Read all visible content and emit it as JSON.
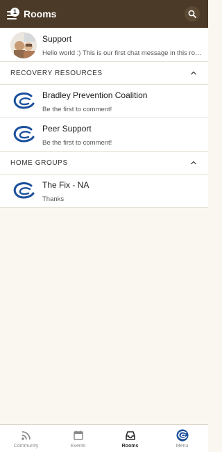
{
  "header": {
    "title": "Rooms",
    "notification_count": "1"
  },
  "rooms_top": [
    {
      "name": "Support",
      "last_message": "Hello world :) This is our first chat message in this room"
    }
  ],
  "sections": [
    {
      "label": "RECOVERY RESOURCES",
      "rooms": [
        {
          "name": "Bradley Prevention Coalition",
          "last_message": "Be the first to comment!"
        },
        {
          "name": "Peer Support",
          "last_message": "Be the first to comment!"
        }
      ]
    },
    {
      "label": "HOME GROUPS",
      "rooms": [
        {
          "name": "The Fix - NA",
          "last_message": "Thanks"
        }
      ]
    }
  ],
  "bottom_nav": {
    "tabs": [
      {
        "label": "Community",
        "icon": "rss-icon",
        "active": false
      },
      {
        "label": "Events",
        "icon": "calendar-icon",
        "active": false
      },
      {
        "label": "Rooms",
        "icon": "inbox-icon",
        "active": true
      },
      {
        "label": "Menu",
        "icon": "app-logo-icon",
        "active": false
      }
    ]
  },
  "colors": {
    "header_bg": "#4a3a27",
    "brand_blue": "#1a4f9c",
    "page_bg": "#faf7f0"
  }
}
